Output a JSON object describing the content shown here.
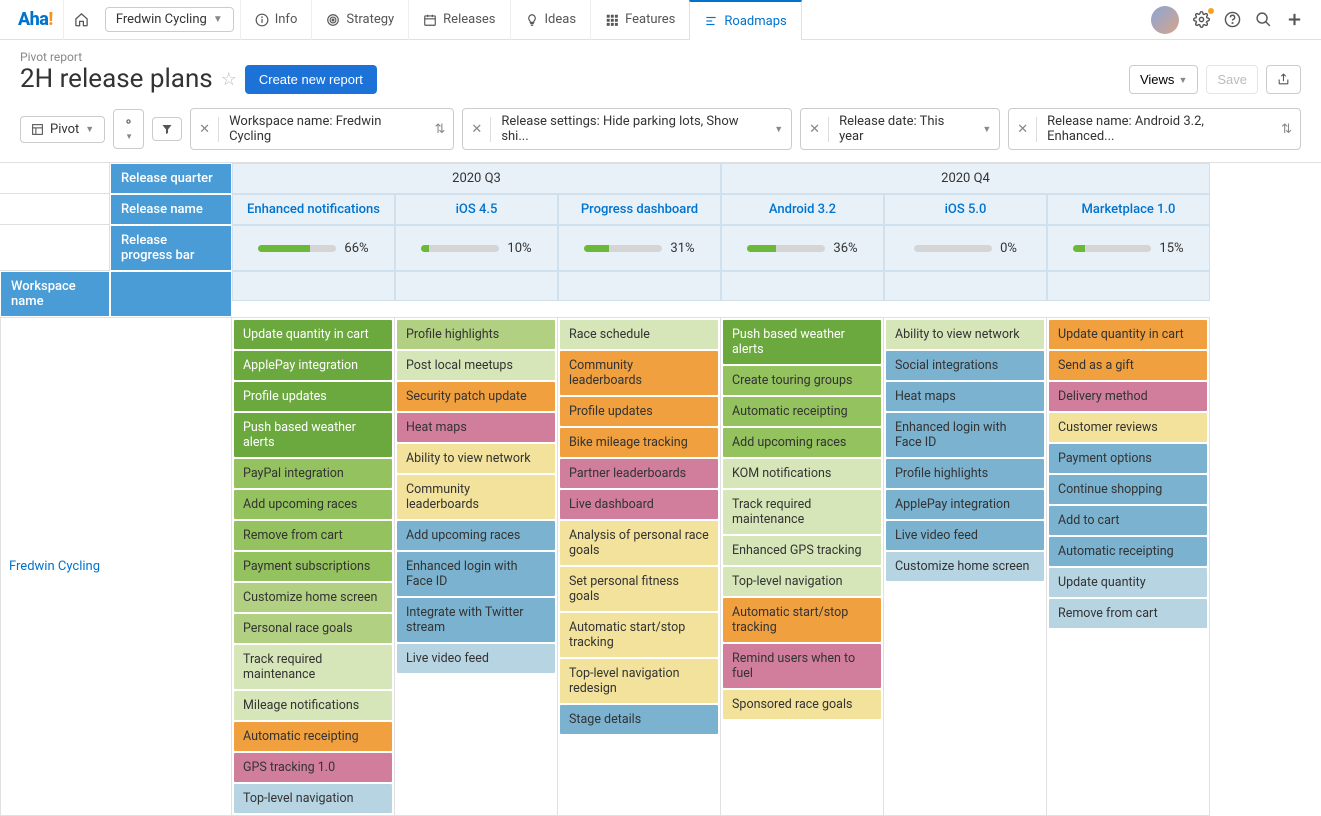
{
  "nav": {
    "logo": "Aha",
    "workspace": "Fredwin Cycling",
    "tabs": {
      "info": "Info",
      "strategy": "Strategy",
      "releases": "Releases",
      "ideas": "Ideas",
      "features": "Features",
      "roadmaps": "Roadmaps"
    }
  },
  "header": {
    "breadcrumb": "Pivot report",
    "title": "2H release plans",
    "create_btn": "Create new report",
    "views_btn": "Views",
    "save_btn": "Save"
  },
  "filters": {
    "pivot_btn": "Pivot",
    "workspace": "Workspace name: Fredwin Cycling",
    "release_settings": "Release settings: Hide parking lots, Show shi...",
    "release_date": "Release date: This year",
    "release_name": "Release name: Android 3.2, Enhanced..."
  },
  "pivot": {
    "row_headers": {
      "quarter": "Release quarter",
      "name": "Release name",
      "progress": "Release progress bar",
      "workspace": "Workspace name"
    },
    "quarters": [
      "2020 Q3",
      "2020 Q4"
    ],
    "releases": [
      {
        "name": "Enhanced notifications",
        "progress": 66
      },
      {
        "name": "iOS 4.5",
        "progress": 10
      },
      {
        "name": "Progress dashboard",
        "progress": 31
      },
      {
        "name": "Android 3.2",
        "progress": 36
      },
      {
        "name": "iOS 5.0",
        "progress": 0
      },
      {
        "name": "Marketplace 1.0",
        "progress": 15
      }
    ],
    "workspace_row_label": "Fredwin Cycling",
    "columns": [
      [
        {
          "t": "Update quantity in cart",
          "c": "c-greenD"
        },
        {
          "t": "ApplePay integration",
          "c": "c-greenD"
        },
        {
          "t": "Profile updates",
          "c": "c-greenD"
        },
        {
          "t": "Push based weather alerts",
          "c": "c-greenD"
        },
        {
          "t": "PayPal integration",
          "c": "c-greenM"
        },
        {
          "t": "Add upcoming races",
          "c": "c-greenM"
        },
        {
          "t": "Remove from cart",
          "c": "c-greenM"
        },
        {
          "t": "Payment subscriptions",
          "c": "c-greenM"
        },
        {
          "t": "Customize home screen",
          "c": "c-greenL"
        },
        {
          "t": "Personal race goals",
          "c": "c-greenL"
        },
        {
          "t": "Track required maintenance",
          "c": "c-greenP"
        },
        {
          "t": "Mileage notifications",
          "c": "c-greenP"
        },
        {
          "t": "Automatic receipting",
          "c": "c-orange"
        },
        {
          "t": "GPS tracking 1.0",
          "c": "c-pink"
        },
        {
          "t": "Top-level navigation",
          "c": "c-blueL"
        }
      ],
      [
        {
          "t": "Profile highlights",
          "c": "c-greenL"
        },
        {
          "t": "Post local meetups",
          "c": "c-greenP"
        },
        {
          "t": "Security patch update",
          "c": "c-orange"
        },
        {
          "t": "Heat maps",
          "c": "c-pink"
        },
        {
          "t": "Ability to view network",
          "c": "c-yellow"
        },
        {
          "t": "Community leaderboards",
          "c": "c-yellow"
        },
        {
          "t": "Add upcoming races",
          "c": "c-blueM"
        },
        {
          "t": "Enhanced login with Face ID",
          "c": "c-blueM"
        },
        {
          "t": "Integrate with Twitter stream",
          "c": "c-blueM"
        },
        {
          "t": "Live video feed",
          "c": "c-blueL"
        }
      ],
      [
        {
          "t": "Race schedule",
          "c": "c-greenP"
        },
        {
          "t": "Community leaderboards",
          "c": "c-orange"
        },
        {
          "t": "Profile updates",
          "c": "c-orange"
        },
        {
          "t": "Bike mileage tracking",
          "c": "c-orange"
        },
        {
          "t": "Partner leaderboards",
          "c": "c-pink"
        },
        {
          "t": "Live dashboard",
          "c": "c-pink"
        },
        {
          "t": "Analysis of personal race goals",
          "c": "c-yellow"
        },
        {
          "t": "Set personal fitness goals",
          "c": "c-yellow"
        },
        {
          "t": "Automatic start/stop tracking",
          "c": "c-yellow"
        },
        {
          "t": "Top-level navigation redesign",
          "c": "c-yellow"
        },
        {
          "t": "Stage details",
          "c": "c-blueM"
        }
      ],
      [
        {
          "t": "Push based weather alerts",
          "c": "c-greenD"
        },
        {
          "t": "Create touring groups",
          "c": "c-greenM"
        },
        {
          "t": "Automatic receipting",
          "c": "c-greenM"
        },
        {
          "t": "Add upcoming races",
          "c": "c-greenM"
        },
        {
          "t": "KOM notifications",
          "c": "c-greenP"
        },
        {
          "t": "Track required maintenance",
          "c": "c-greenP"
        },
        {
          "t": "Enhanced GPS tracking",
          "c": "c-greenP"
        },
        {
          "t": "Top-level navigation",
          "c": "c-greenP"
        },
        {
          "t": "Automatic start/stop tracking",
          "c": "c-orange"
        },
        {
          "t": "Remind users when to fuel",
          "c": "c-pink"
        },
        {
          "t": "Sponsored race goals",
          "c": "c-yellow"
        }
      ],
      [
        {
          "t": "Ability to view network",
          "c": "c-greenP"
        },
        {
          "t": "Social integrations",
          "c": "c-blueM"
        },
        {
          "t": "Heat maps",
          "c": "c-blueM"
        },
        {
          "t": "Enhanced login with Face ID",
          "c": "c-blueM"
        },
        {
          "t": "Profile highlights",
          "c": "c-blueM"
        },
        {
          "t": "ApplePay integration",
          "c": "c-blueM"
        },
        {
          "t": "Live video feed",
          "c": "c-blueM"
        },
        {
          "t": "Customize home screen",
          "c": "c-blueL"
        }
      ],
      [
        {
          "t": "Update quantity in cart",
          "c": "c-orange"
        },
        {
          "t": "Send as a gift",
          "c": "c-orange"
        },
        {
          "t": "Delivery method",
          "c": "c-pink"
        },
        {
          "t": "Customer reviews",
          "c": "c-yellow"
        },
        {
          "t": "Payment options",
          "c": "c-blueM"
        },
        {
          "t": "Continue shopping",
          "c": "c-blueM"
        },
        {
          "t": "Add to cart",
          "c": "c-blueM"
        },
        {
          "t": "Automatic receipting",
          "c": "c-blueM"
        },
        {
          "t": "Update quantity",
          "c": "c-blueL"
        },
        {
          "t": "Remove from cart",
          "c": "c-blueL"
        }
      ]
    ]
  }
}
